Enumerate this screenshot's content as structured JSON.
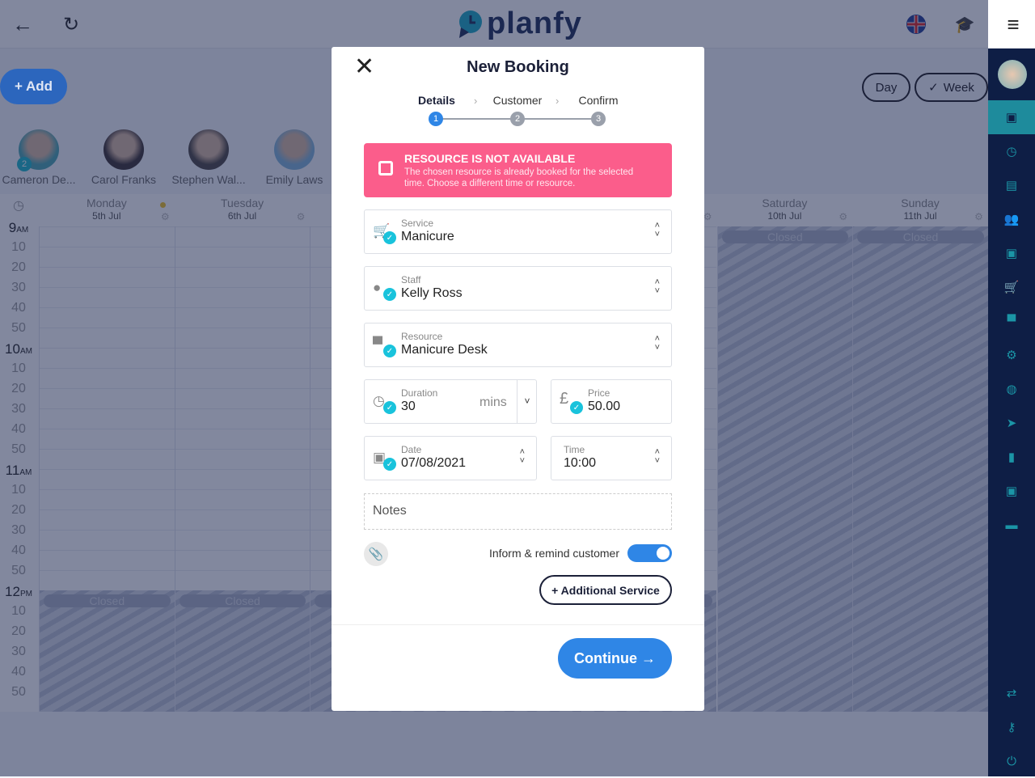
{
  "header": {
    "app_name": "planfy",
    "back_icon": "arrow-left-icon",
    "reload_icon": "reload-icon",
    "language_flag": "uk-flag-icon",
    "learn_icon": "graduation-cap-icon",
    "menu_icon": "hamburger-icon"
  },
  "toolbar": {
    "add_label": "+ Add",
    "day_label": "Day",
    "week_label": "Week",
    "week_selected": true
  },
  "staff": [
    {
      "name": "Cameron De...",
      "badge": "2",
      "color": "#4aa5b0"
    },
    {
      "name": "Carol Franks",
      "color": "#3a3030"
    },
    {
      "name": "Stephen Wal...",
      "color": "#4a4440"
    },
    {
      "name": "Emily Laws",
      "color": "#7fb2d8"
    }
  ],
  "calendar": {
    "days": [
      {
        "name": "Monday",
        "date": "5th Jul",
        "closed_from": "12PM"
      },
      {
        "name": "Tuesday",
        "date": "6th Jul",
        "closed_from": "12PM"
      },
      {
        "name": "",
        "date": "",
        "closed_from": "12PM"
      },
      {
        "name": "",
        "date": "",
        "closed_from": "12PM"
      },
      {
        "name": "",
        "date": "",
        "closed_from": "12PM"
      },
      {
        "name": "Saturday",
        "date": "10th Jul",
        "closed_from": "all"
      },
      {
        "name": "Sunday",
        "date": "11th Jul",
        "closed_from": "all"
      }
    ],
    "closed_label": "Closed",
    "hours": [
      {
        "h": "9",
        "ampm": "AM"
      },
      {
        "h": "10",
        "ampm": "AM"
      },
      {
        "h": "11",
        "ampm": "AM"
      },
      {
        "h": "12",
        "ampm": "PM"
      }
    ],
    "minutes": [
      "10",
      "20",
      "30",
      "40",
      "50"
    ]
  },
  "sidebar": {
    "items": [
      "calendar-check-icon",
      "clock-icon",
      "list-icon",
      "users-icon",
      "contact-icon",
      "cart-icon",
      "chair-icon",
      "gear-icon",
      "globe-icon",
      "send-icon",
      "chart-icon",
      "wallet-icon",
      "chat-icon"
    ],
    "bottom": [
      "swap-icon",
      "key-icon",
      "power-icon"
    ],
    "active": 0
  },
  "modal": {
    "title": "New Booking",
    "steps": [
      {
        "label": "Details",
        "n": "1"
      },
      {
        "label": "Customer",
        "n": "2"
      },
      {
        "label": "Confirm",
        "n": "3"
      }
    ],
    "alert": {
      "title": "RESOURCE IS NOT AVAILABLE",
      "message": "The chosen resource is already booked for the selected time. Choose a different time or resource.",
      "color": "#fb5d8b"
    },
    "service": {
      "label": "Service",
      "value": "Manicure"
    },
    "staff": {
      "label": "Staff",
      "value": "Kelly Ross"
    },
    "resource": {
      "label": "Resource",
      "value": "Manicure Desk"
    },
    "duration": {
      "label": "Duration",
      "value": "30",
      "unit": "mins"
    },
    "price": {
      "label": "Price",
      "value": "50.00",
      "currency": "£"
    },
    "date": {
      "label": "Date",
      "value": "07/08/2021"
    },
    "time": {
      "label": "Time",
      "value": "10:00"
    },
    "notes_placeholder": "Notes",
    "remind_label": "Inform & remind customer",
    "remind_on": true,
    "additional_service": "+  Additional Service",
    "continue": "Continue →"
  }
}
